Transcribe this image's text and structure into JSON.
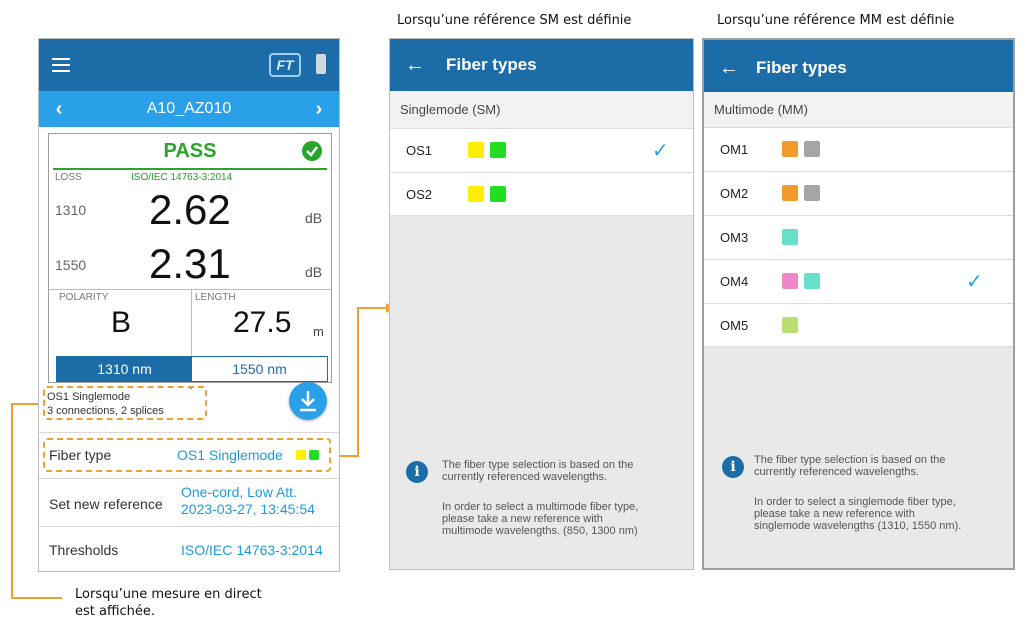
{
  "captions": {
    "sm": "Lorsqu’une référence SM est définie",
    "mm": "Lorsqu’une référence MM est définie",
    "live_line1": "Lorsqu’une mesure en direct",
    "live_line2": "est affichée."
  },
  "phone1": {
    "brand": "FT",
    "test_id": "A10_AZ010",
    "result": "PASS",
    "loss_label": "LOSS",
    "standard": "ISO/IEC 14763-3:2014",
    "measurements": [
      {
        "wavelength": "1310",
        "value": "2.62",
        "unit": "dB"
      },
      {
        "wavelength": "1550",
        "value": "2.31",
        "unit": "dB"
      }
    ],
    "polarity_label": "POLARITY",
    "polarity_value": "B",
    "length_label": "LENGTH",
    "length_value": "27.5",
    "length_unit": "m",
    "tabs": [
      "1310 nm",
      "1550 nm"
    ],
    "fiber_summary_line1": "OS1 Singlemode",
    "fiber_summary_line2": "3 connections, 2 splices",
    "rows": {
      "fiber_type_label": "Fiber type",
      "fiber_type_value": "OS1 Singlemode",
      "reference_label": "Set new reference",
      "reference_value_line1": "One-cord, Low Att.",
      "reference_value_line2": "2023-03-27, 13:45:54",
      "thresholds_label": "Thresholds",
      "thresholds_value": "ISO/IEC 14763-3:2014"
    },
    "colors": {
      "pass": "#2aa52a",
      "appbar": "#1c6ca8",
      "subbar": "#2aa0e8",
      "accent": "#1e9be0",
      "highlight": "#f0a030"
    }
  },
  "phone2": {
    "title": "Fiber types",
    "section": "Singlemode (SM)",
    "fibers": [
      {
        "name": "OS1",
        "colors": [
          "#ffee00",
          "#22dd22"
        ],
        "selected": true
      },
      {
        "name": "OS2",
        "colors": [
          "#ffee00",
          "#22dd22"
        ],
        "selected": false
      }
    ],
    "info_line1": "The fiber type selection is based on the",
    "info_line2": "currently referenced wavelengths.",
    "info_line3": "In order to select a multimode fiber type,",
    "info_line4": "please take a new reference with",
    "info_line5": "multimode wavelengths. (850, 1300 nm)"
  },
  "phone3": {
    "title": "Fiber types",
    "section": "Multimode (MM)",
    "fibers": [
      {
        "name": "OM1",
        "colors": [
          "#f39a2d",
          "#a6a6a6"
        ],
        "selected": false
      },
      {
        "name": "OM2",
        "colors": [
          "#f39a2d",
          "#a6a6a6"
        ],
        "selected": false
      },
      {
        "name": "OM3",
        "colors": [
          "#66e0c8"
        ],
        "selected": false
      },
      {
        "name": "OM4",
        "colors": [
          "#ee88c8",
          "#66e0c8"
        ],
        "selected": true
      },
      {
        "name": "OM5",
        "colors": [
          "#b8e070"
        ],
        "selected": false
      }
    ],
    "info_line1": "The fiber type selection is based on the",
    "info_line2": "currently referenced wavelengths.",
    "info_line3": "In order to select a singlemode fiber type,",
    "info_line4": "please take a new reference with",
    "info_line5": "singlemode wavelengths (1310, 1550 nm)."
  }
}
